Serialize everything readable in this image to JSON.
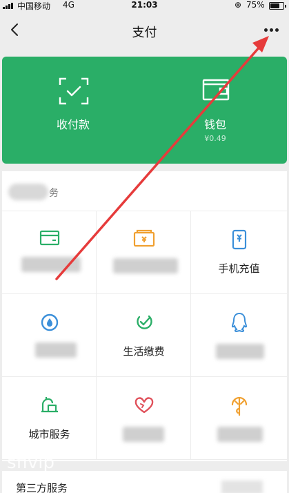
{
  "status_bar": {
    "carrier": "中国移动",
    "network": "4G",
    "time": "21:03",
    "battery": "75%",
    "battery_level": 0.75
  },
  "nav": {
    "title": "支付"
  },
  "pay_card": {
    "color": "#2aae67",
    "left_label": "收付款",
    "left_icon": "scan-pay-icon",
    "right_label": "钱包",
    "right_icon": "wallet-icon",
    "balance": "¥0.49"
  },
  "services": {
    "header_suffix": "务",
    "cells": [
      {
        "label": "",
        "icon": "card-icon",
        "icon_color": "#2aae67",
        "blurred": true
      },
      {
        "label": "",
        "icon": "wallet-orange-icon",
        "icon_color": "#f0a030",
        "blurred": true
      },
      {
        "label": "手机充值",
        "icon": "phone-recharge-icon",
        "icon_color": "#3b8fd9",
        "blurred": false
      },
      {
        "label": "",
        "icon": "drop-icon",
        "icon_color": "#3b8fd9",
        "blurred": true
      },
      {
        "label": "生活缴费",
        "icon": "check-leaf-icon",
        "icon_color": "#2aae67",
        "blurred": false
      },
      {
        "label": "",
        "icon": "qq-icon",
        "icon_color": "#3b8fd9",
        "blurred": true
      },
      {
        "label": "城市服务",
        "icon": "city-icon",
        "icon_color": "#2aae67",
        "blurred": false
      },
      {
        "label": "",
        "icon": "heart-icon",
        "icon_color": "#e0505a",
        "blurred": true
      },
      {
        "label": "",
        "icon": "insurance-icon",
        "icon_color": "#f0a030",
        "blurred": true
      }
    ]
  },
  "watermark": "sfivip",
  "third_party": {
    "title": "第三方服务"
  },
  "annotation": {
    "color": "#e63b3b"
  }
}
